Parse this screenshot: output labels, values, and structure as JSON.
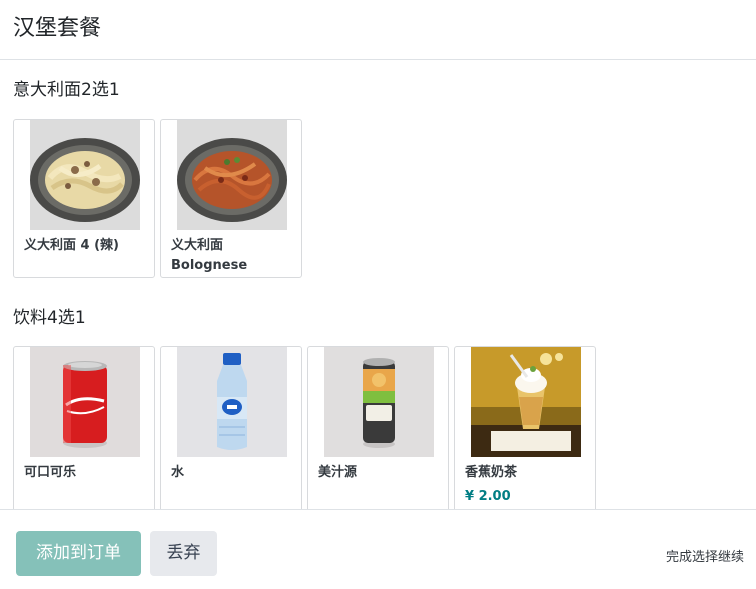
{
  "header": {
    "title": "汉堡套餐"
  },
  "sections": [
    {
      "title": "意大利面2选1",
      "items": [
        {
          "name": "义大利面 4 (辣)",
          "icon": "pasta-carbonara-image"
        },
        {
          "name": "义大利面 Bolognese",
          "icon": "pasta-bolognese-image"
        }
      ]
    },
    {
      "title": "饮料4选1",
      "items": [
        {
          "name": "可口可乐",
          "icon": "coca-cola-can-image"
        },
        {
          "name": "水",
          "icon": "water-bottle-image"
        },
        {
          "name": "美汁源",
          "icon": "minute-maid-can-image"
        },
        {
          "name": "香蕉奶茶",
          "price": "¥ 2.00",
          "icon": "banana-milkshake-image"
        }
      ]
    }
  ],
  "footer": {
    "add_label": "添加到订单",
    "discard_label": "丢弃",
    "hint": "完成选择继续"
  },
  "colors": {
    "accent": "#85c1b9",
    "price": "#017e84",
    "secondary_btn": "#e7e9ed"
  }
}
